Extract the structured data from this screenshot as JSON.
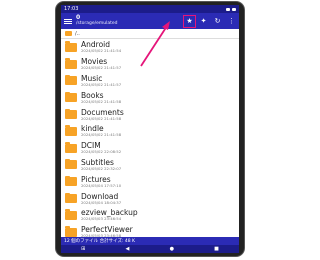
{
  "status_bar": {
    "time": "17:03"
  },
  "toolbar": {
    "count": "0",
    "path": "/storage/emulated",
    "icons": [
      "star-icon",
      "pin-icon",
      "refresh-icon",
      "more-icon"
    ]
  },
  "path_row": {
    "label": "/.."
  },
  "items": [
    {
      "name": "Android",
      "date": "2024/05/02 21:41:54"
    },
    {
      "name": "Movies",
      "date": "2024/05/02 21:41:57"
    },
    {
      "name": "Music",
      "date": "2024/05/02 21:41:57"
    },
    {
      "name": "Books",
      "date": "2024/05/02 21:41:58"
    },
    {
      "name": "Documents",
      "date": "2024/05/02 21:41:58"
    },
    {
      "name": "kindle",
      "date": "2024/05/02 21:41:58"
    },
    {
      "name": "DCIM",
      "date": "2024/05/02 22:08:52"
    },
    {
      "name": "Subtitles",
      "date": "2024/05/02 22:32:07"
    },
    {
      "name": "Pictures",
      "date": "2024/05/04 17:57:10"
    },
    {
      "name": "Download",
      "date": "2024/05/04 18:04:37"
    },
    {
      "name": "ezview_backup",
      "date": "2024/05/03 23:46:54"
    },
    {
      "name": "PerfectViewer",
      "date": "2024/05/03 23:46:58"
    }
  ],
  "footer": {
    "text": "12 個のファイル 合計サイズ: 48 K"
  },
  "colors": {
    "toolbar": "#2b2bb5",
    "folder": "#f7a326",
    "highlight": "#e5157a"
  }
}
